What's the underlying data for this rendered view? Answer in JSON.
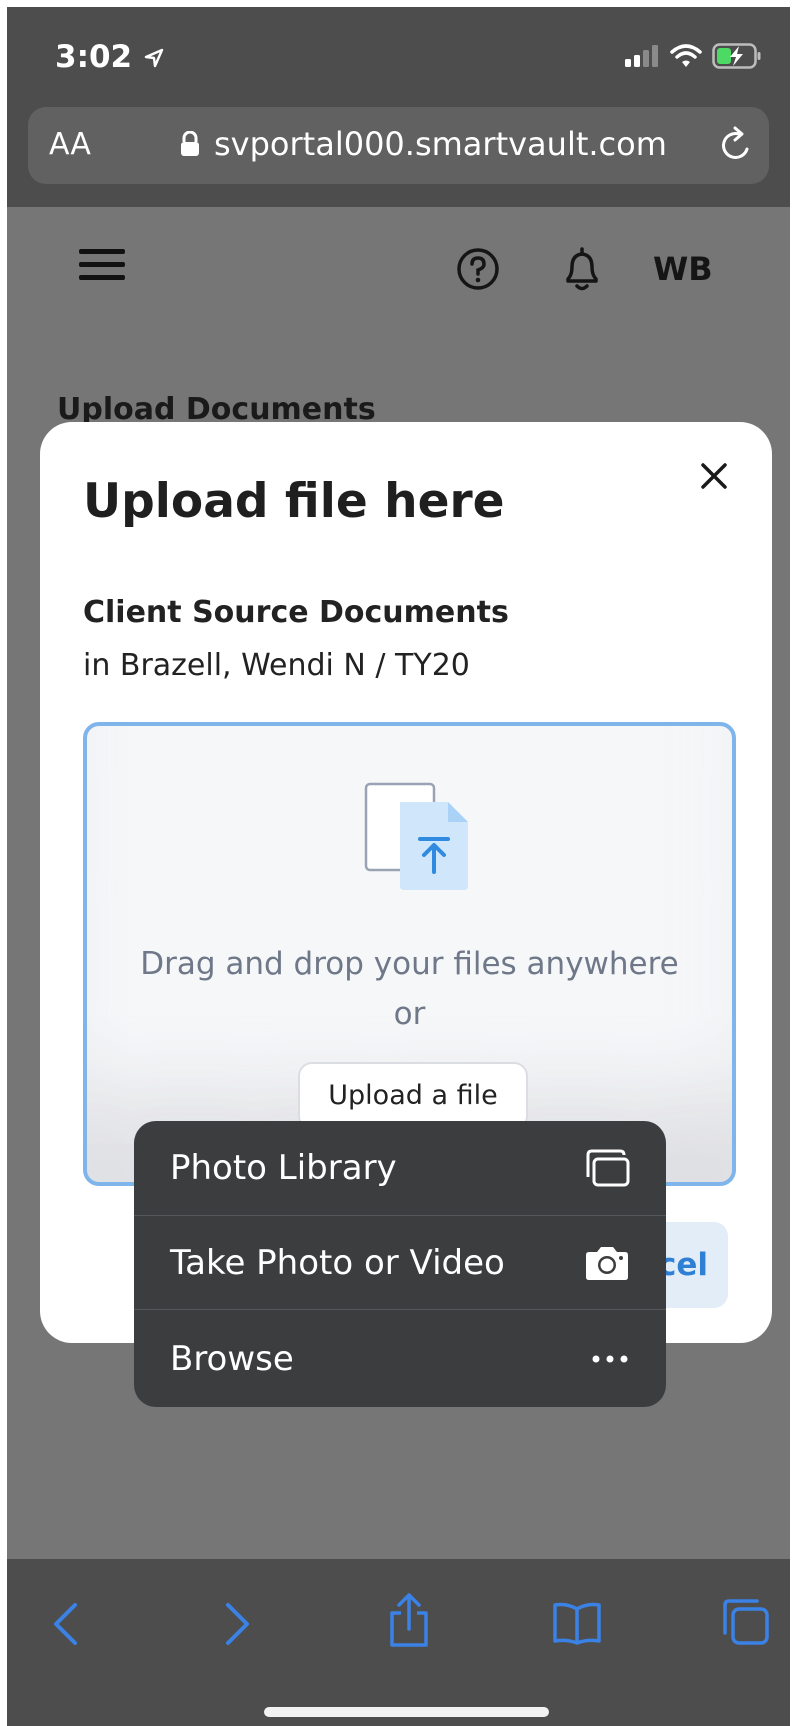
{
  "status": {
    "time": "3:02"
  },
  "url_bar": {
    "text_size": "AA",
    "url": "svportal000.smartvault.com"
  },
  "header": {
    "avatar_initials": "WB",
    "page_title": "Upload Documents"
  },
  "modal": {
    "title": "Upload file here",
    "folder": "Client Source Documents",
    "path": "in Brazell, Wendi N / TY20",
    "drop_text": "Drag and drop your files anywhere",
    "drop_or": "or",
    "upload_button": "Upload a file",
    "cancel_partial": "cel"
  },
  "action_menu": {
    "items": [
      {
        "label": "Photo Library",
        "icon": "photo-library-icon"
      },
      {
        "label": "Take Photo or Video",
        "icon": "camera-icon"
      },
      {
        "label": "Browse",
        "icon": "more-icon"
      }
    ]
  },
  "colors": {
    "accent": "#2f7fd4",
    "dropzone_border": "#7fb5ea",
    "toolbar_icon": "#3b82e6"
  }
}
